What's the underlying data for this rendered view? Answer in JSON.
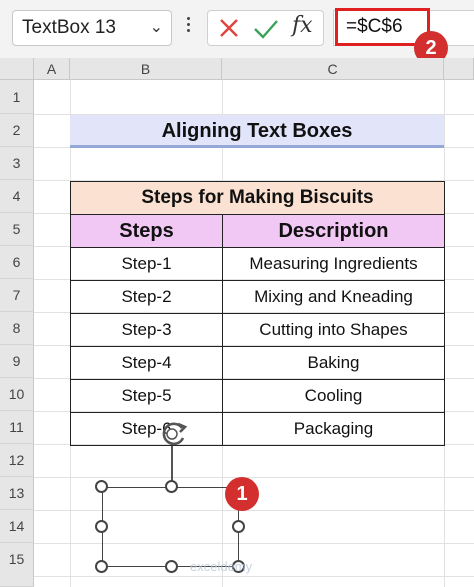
{
  "formula_bar": {
    "name_box": "TextBox 13",
    "formula": "=$C$6"
  },
  "columns": [
    "A",
    "B",
    "C"
  ],
  "rows": [
    "1",
    "2",
    "3",
    "4",
    "5",
    "6",
    "7",
    "8",
    "9",
    "10",
    "11",
    "12",
    "13",
    "14",
    "15"
  ],
  "sheet": {
    "title": "Aligning Text Boxes",
    "table": {
      "caption": "Steps for Making Biscuits",
      "headers": [
        "Steps",
        "Description"
      ],
      "rows": [
        [
          "Step-1",
          "Measuring Ingredients"
        ],
        [
          "Step-2",
          "Mixing and Kneading"
        ],
        [
          "Step-3",
          "Cutting into Shapes"
        ],
        [
          "Step-4",
          "Baking"
        ],
        [
          "Step-5",
          "Cooling"
        ],
        [
          "Step-6",
          "Packaging"
        ]
      ]
    }
  },
  "callouts": {
    "badge_1": "1",
    "badge_2": "2"
  },
  "watermark": "exceldemy",
  "colors": {
    "highlight_red": "#e02020",
    "badge_red": "#d32f2f",
    "title_fill": "#e2e4fa",
    "caption_fill": "#fbe1d2",
    "header_fill": "#f1c7f3"
  }
}
